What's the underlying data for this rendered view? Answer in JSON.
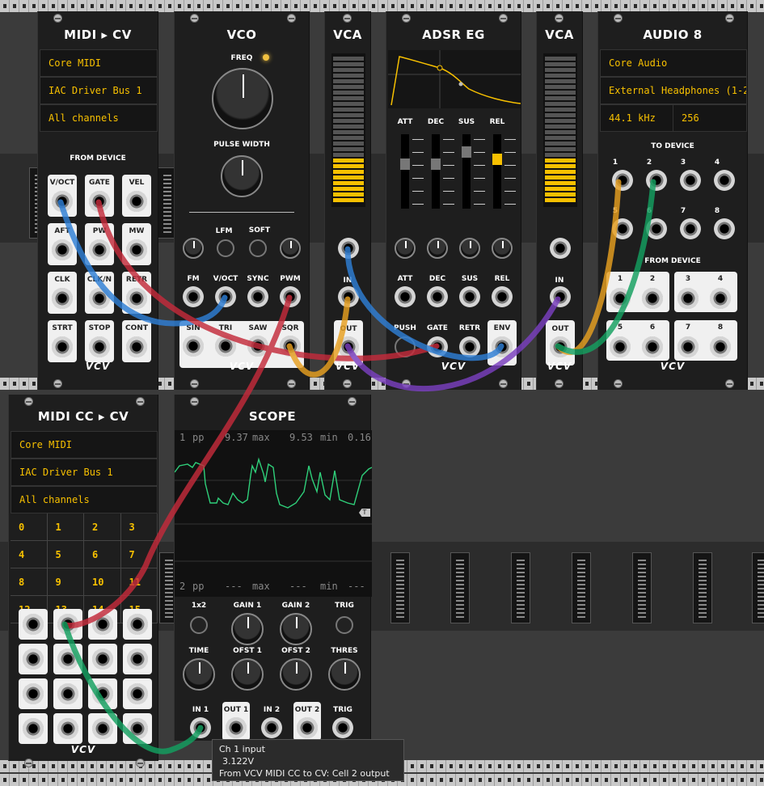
{
  "modules": {
    "midi_cv": {
      "title": "MIDI ▸ CV",
      "driver": "Core MIDI",
      "device": "IAC Driver Bus 1",
      "channel": "All channels",
      "section": "FROM DEVICE",
      "jacks": [
        "V/OCT",
        "GATE",
        "VEL",
        "AFT",
        "PW",
        "MW",
        "CLK",
        "CLK/N",
        "RETR",
        "STRT",
        "STOP",
        "CONT"
      ],
      "brand": "VCV"
    },
    "vco": {
      "title": "VCO",
      "freq_label": "FREQ",
      "pw_label": "PULSE WIDTH",
      "lfm_label": "LFM",
      "soft_label": "SOFT",
      "inputs": [
        "FM",
        "V/OCT",
        "SYNC",
        "PWM"
      ],
      "outputs": [
        "SIN",
        "TRI",
        "SAW",
        "SQR"
      ],
      "brand": "VCV"
    },
    "vca1": {
      "title": "VCA",
      "in_label": "IN",
      "out_label": "OUT",
      "brand": "VCV"
    },
    "adsr": {
      "title": "ADSR EG",
      "sliders": [
        "ATT",
        "DEC",
        "SUS",
        "REL"
      ],
      "inputs": [
        "ATT",
        "DEC",
        "SUS",
        "REL"
      ],
      "bottom": [
        "PUSH",
        "GATE",
        "RETR",
        "ENV"
      ],
      "brand": "VCV"
    },
    "vca2": {
      "title": "VCA",
      "in_label": "IN",
      "out_label": "OUT",
      "brand": "VCV"
    },
    "audio8": {
      "title": "AUDIO 8",
      "driver": "Core Audio",
      "device": "External Headphones (1-2",
      "rate": "44.1 kHz",
      "block": "256",
      "to_device": "TO DEVICE",
      "from_device": "FROM DEVICE",
      "channels": [
        "1",
        "2",
        "3",
        "4",
        "5",
        "6",
        "7",
        "8"
      ],
      "brand": "VCV"
    },
    "midi_cc": {
      "title": "MIDI CC ▸ CV",
      "driver": "Core MIDI",
      "device": "IAC Driver Bus 1",
      "channel": "All channels",
      "cells": [
        "0",
        "1",
        "2",
        "3",
        "4",
        "5",
        "6",
        "7",
        "8",
        "9",
        "10",
        "11",
        "12",
        "13",
        "14",
        "15"
      ],
      "brand": "VCV"
    },
    "scope": {
      "title": "SCOPE",
      "ch1_stats": [
        "1",
        "pp",
        "9.37",
        "max",
        "9.53",
        "min",
        "0.16"
      ],
      "ch2_stats": [
        "2",
        "pp",
        "---",
        "max",
        "---",
        "min",
        "---"
      ],
      "trig_marker": "T",
      "controls": [
        "1x2",
        "GAIN 1",
        "GAIN 2",
        "TRIG",
        "TIME",
        "OFST 1",
        "OFST 2",
        "THRES"
      ],
      "jacks": [
        "IN 1",
        "OUT 1",
        "IN 2",
        "OUT 2",
        "TRIG"
      ]
    }
  },
  "tooltip": {
    "line1": "Ch 1 input",
    "line2": "3.122V",
    "line3": "From VCV MIDI CC to CV: Cell 2 output"
  },
  "colors": {
    "cable_blue": "#2f7fd6",
    "cable_red": "#c42b3b",
    "cable_yellow": "#e8a020",
    "cable_purple": "#7a3fbf",
    "cable_green": "#14a060",
    "display_text": "#f7c000"
  }
}
